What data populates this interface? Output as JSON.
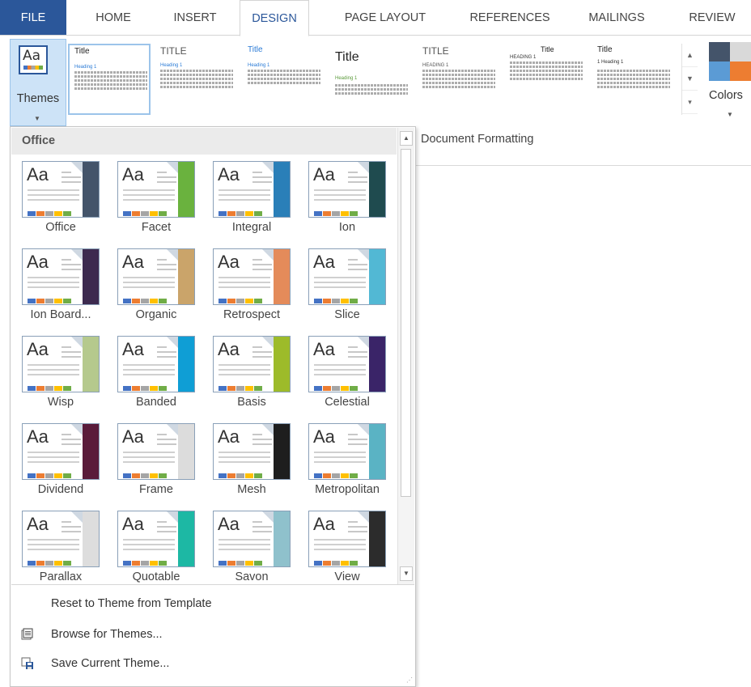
{
  "tabs": {
    "file": "FILE",
    "home": "HOME",
    "insert": "INSERT",
    "design": "DESIGN",
    "page_layout": "PAGE LAYOUT",
    "references": "REFERENCES",
    "mailings": "MAILINGS",
    "review": "REVIEW"
  },
  "ribbon": {
    "themes_label": "Themes",
    "colors_label": "Colors",
    "gallery": [
      {
        "title": "Title",
        "heading": "Heading 1"
      },
      {
        "title": "TITLE",
        "heading": "Heading 1"
      },
      {
        "title": "Title",
        "heading": "Heading 1"
      },
      {
        "title": "Title",
        "heading": "Heading 1"
      },
      {
        "title": "TITLE",
        "heading": "HEADING 1"
      },
      {
        "title": "Title",
        "heading": "HEADING 1"
      },
      {
        "title": "Title",
        "heading": "1 Heading 1"
      }
    ]
  },
  "document": {
    "group_label": "Document Formatting"
  },
  "themes_dropdown": {
    "section_label": "Office",
    "themes": [
      {
        "name": "Office",
        "accent": "#44546a",
        "font": "Aa"
      },
      {
        "name": "Facet",
        "accent": "#6ab23e",
        "font": "Aa"
      },
      {
        "name": "Integral",
        "accent": "#2a7fb8",
        "font": "Aa"
      },
      {
        "name": "Ion",
        "accent": "#1f4b4f",
        "font": "Aa"
      },
      {
        "name": "Ion Board...",
        "accent": "#3d2a4f",
        "font": "Aa"
      },
      {
        "name": "Organic",
        "accent": "#caa46a",
        "font": "Aa"
      },
      {
        "name": "Retrospect",
        "accent": "#e48b5a",
        "font": "Aa"
      },
      {
        "name": "Slice",
        "accent": "#52b8d4",
        "font": "Aa"
      },
      {
        "name": "Wisp",
        "accent": "#b5c98d",
        "font": "Aa"
      },
      {
        "name": "Banded",
        "accent": "#0f9ed5",
        "font": "Aa"
      },
      {
        "name": "Basis",
        "accent": "#9dbb2a",
        "font": "Aa"
      },
      {
        "name": "Celestial",
        "accent": "#3a2468",
        "font": "Aa"
      },
      {
        "name": "Dividend",
        "accent": "#5a1b3a",
        "font": "Aa"
      },
      {
        "name": "Frame",
        "accent": "#dcdcdc",
        "font": "Aa"
      },
      {
        "name": "Mesh",
        "accent": "#1e1e1e",
        "font": "Aa"
      },
      {
        "name": "Metropolitan",
        "accent": "#5ab3c4",
        "font": "Aa"
      },
      {
        "name": "Parallax",
        "accent": "#dddddd",
        "font": "Aa"
      },
      {
        "name": "Quotable",
        "accent": "#1db8a4",
        "font": "Aa"
      },
      {
        "name": "Savon",
        "accent": "#8fc1cc",
        "font": "Aa"
      },
      {
        "name": "View",
        "accent": "#2c2c2c",
        "font": "Aa"
      }
    ],
    "menu": {
      "reset": "Reset to Theme from Template",
      "browse": "Browse for Themes...",
      "save": "Save Current Theme..."
    }
  },
  "colors": {
    "accent_blue": "#2b579a",
    "selected_bg": "#cde3f7"
  }
}
